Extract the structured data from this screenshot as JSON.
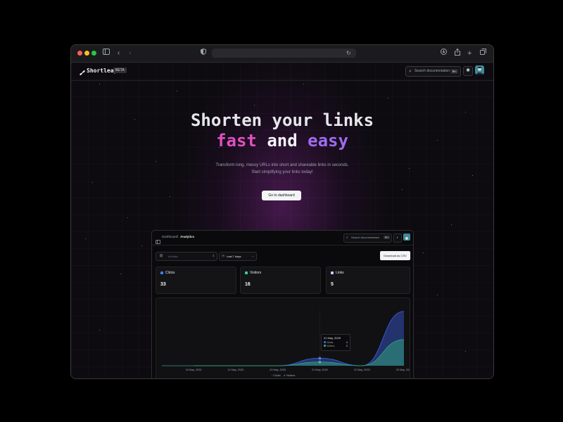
{
  "browser": {
    "traffic_lights": [
      "#ff5f57",
      "#febc2e",
      "#28c840"
    ]
  },
  "nav": {
    "brand": "Shortleap",
    "badge": "BETA",
    "search_placeholder": "Search documentation",
    "search_shortcut": "⌘K"
  },
  "hero": {
    "title_line1": "Shorten your links",
    "title_fast": "fast",
    "title_and": "and",
    "title_easy": "easy",
    "subtitle": "Transform long, messy URLs into short and shareable links in seconds. Start simplifying your links today!",
    "cta": "Go to dashboard",
    "colors": {
      "fast": "#e050c0",
      "easy": "#a06bf0"
    }
  },
  "dashboard": {
    "breadcrumb_root": "Dashboard",
    "breadcrumb_sep": "/",
    "breadcrumb_current": "Analytics",
    "search_placeholder": "Search documentation",
    "search_shortcut": "⌘K",
    "links_filter": "All links",
    "date_filter": "Last 7 days",
    "download_button": "Download as CSV",
    "cards": [
      {
        "label": "Clicks",
        "value": "33",
        "color": "#3b82f6"
      },
      {
        "label": "Visitors",
        "value": "16",
        "color": "#34d399"
      },
      {
        "label": "Links",
        "value": "5",
        "color": "#c7d2fe"
      }
    ],
    "tooltip": {
      "date": "21 May, 2025",
      "rows": [
        {
          "label": "Clicks",
          "value": "4"
        },
        {
          "label": "Visitors",
          "value": "2"
        }
      ]
    },
    "legend": [
      "Clicks",
      "Visitors"
    ]
  },
  "chart_data": {
    "type": "area",
    "x": [
      "18 May, 2025",
      "19 May, 2025",
      "20 May, 2025",
      "21 May, 2025",
      "22 May, 2025",
      "23 May, 2025"
    ],
    "series": [
      {
        "name": "Clicks",
        "values": [
          0,
          0,
          0,
          4,
          0,
          29
        ],
        "color": "#3b5bdb"
      },
      {
        "name": "Visitors",
        "values": [
          0,
          0,
          0,
          2,
          0,
          14
        ],
        "color": "#2f9e7a"
      }
    ],
    "ylim": [
      0,
      30
    ],
    "grid": false,
    "legend": "bottom"
  }
}
